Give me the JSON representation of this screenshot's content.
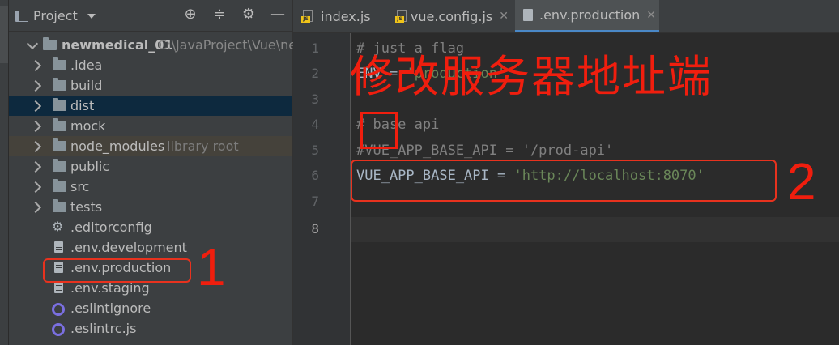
{
  "project_panel": {
    "title": "Project",
    "header_icons": [
      "target-icon",
      "collapse-icon",
      "gear-icon",
      "minimize-icon"
    ],
    "tree": [
      {
        "name": "newmedical_01",
        "path": "C:\\JavaProject\\Vue\\ne",
        "type": "folder",
        "expanded": true
      },
      {
        "name": ".idea",
        "type": "folder"
      },
      {
        "name": "build",
        "type": "folder"
      },
      {
        "name": "dist",
        "type": "folder",
        "selected": true
      },
      {
        "name": "mock",
        "type": "folder"
      },
      {
        "name": "node_modules",
        "hint": "library root",
        "type": "folder"
      },
      {
        "name": "public",
        "type": "folder"
      },
      {
        "name": "src",
        "type": "folder"
      },
      {
        "name": "tests",
        "type": "folder"
      },
      {
        "name": ".editorconfig",
        "type": "config"
      },
      {
        "name": ".env.development",
        "type": "file"
      },
      {
        "name": ".env.production",
        "type": "file",
        "highlighted": true
      },
      {
        "name": ".env.staging",
        "type": "file"
      },
      {
        "name": ".eslintignore",
        "type": "eslint"
      },
      {
        "name": ".eslintrc.js",
        "type": "eslint"
      }
    ]
  },
  "tabs": [
    {
      "label": "index.js",
      "icon": "js-file-icon",
      "active": false
    },
    {
      "label": "vue.config.js",
      "icon": "js-file-icon",
      "active": false
    },
    {
      "label": ".env.production",
      "icon": "text-file-icon",
      "active": true
    }
  ],
  "editor": {
    "line_numbers": [
      "1",
      "2",
      "3",
      "4",
      "5",
      "6",
      "7",
      "8"
    ],
    "current_line": "8",
    "lines": [
      "# just a flag",
      "ENV = 'production'",
      "",
      "# base api",
      "#VUE_APP_BASE_API = '/prod-api'",
      "VUE_APP_BASE_API = 'http://localhost:8070'",
      "",
      ""
    ]
  },
  "annotations": {
    "headline": "修改服务器地址端",
    "marker_1": "1",
    "marker_2": "2",
    "color": "#f01e0e"
  }
}
